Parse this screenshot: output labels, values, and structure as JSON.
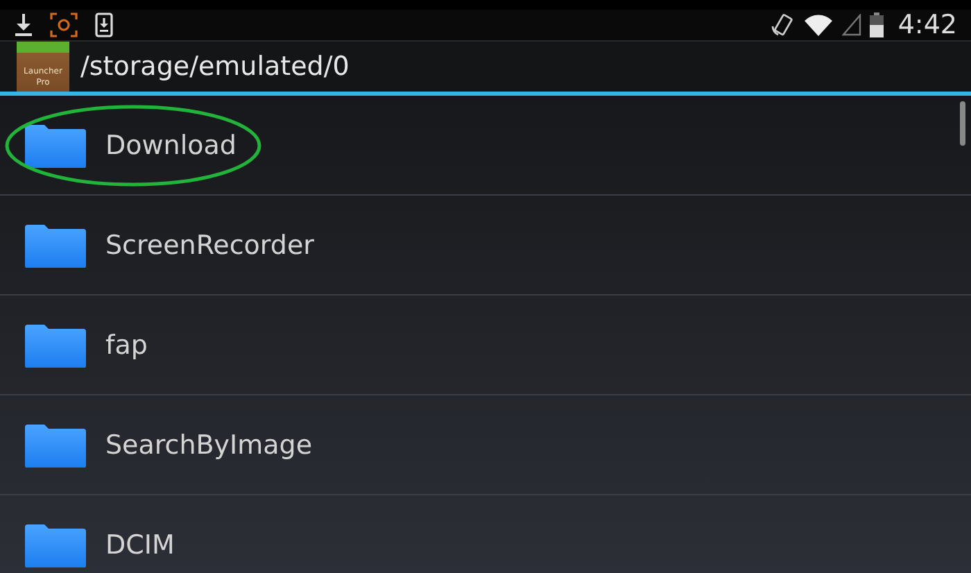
{
  "status_bar": {
    "time": "4:42"
  },
  "header": {
    "app_icon_text": [
      "Launcher",
      "Pro"
    ],
    "path": "/storage/emulated/0"
  },
  "folders": [
    {
      "name": "Download",
      "circled": true
    },
    {
      "name": "ScreenRecorder",
      "circled": false
    },
    {
      "name": "fap",
      "circled": false
    },
    {
      "name": "SearchByImage",
      "circled": false
    },
    {
      "name": "DCIM",
      "circled": false
    }
  ]
}
